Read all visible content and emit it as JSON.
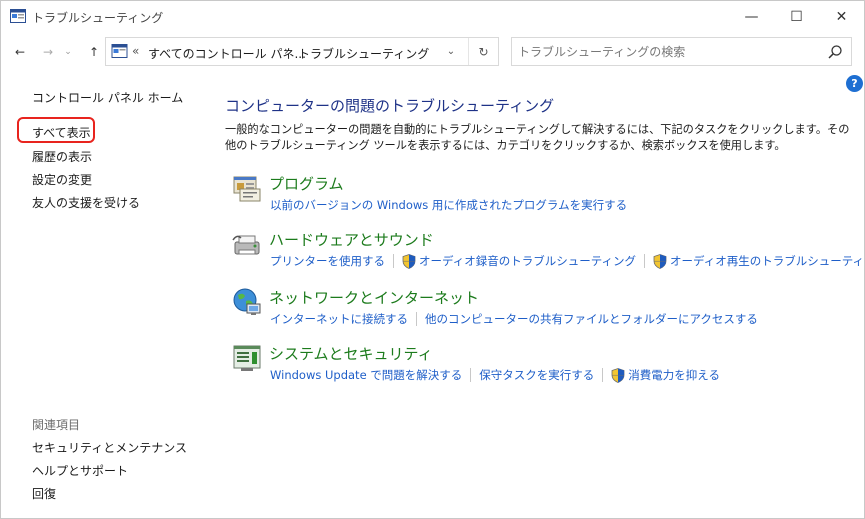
{
  "window": {
    "title": "トラブルシューティング",
    "minimize_glyph": "—",
    "maximize_glyph": "☐",
    "close_glyph": "✕"
  },
  "nav": {
    "back_glyph": "←",
    "forward_glyph": "→",
    "recent_glyph": "⌄",
    "up_glyph": "↑"
  },
  "address": {
    "overflow": "«",
    "crumb1": "すべてのコントロール パネ...",
    "separator": "›",
    "crumb2": "トラブルシューティング",
    "dropdown_glyph": "⌄",
    "refresh_glyph": "↻"
  },
  "search": {
    "placeholder": "トラブルシューティングの検索"
  },
  "help_glyph": "?",
  "sidebar": {
    "home": "コントロール パネル ホーム",
    "items": [
      "すべて表示",
      "履歴の表示",
      "設定の変更",
      "友人の支援を受ける"
    ],
    "see_also_title": "関連項目",
    "see_also": [
      "セキュリティとメンテナンス",
      "ヘルプとサポート",
      "回復"
    ]
  },
  "main": {
    "title": "コンピューターの問題のトラブルシューティング",
    "description": "一般的なコンピューターの問題を自動的にトラブルシューティングして解決するには、下記のタスクをクリックします。その他のトラブルシューティング ツールを表示するには、カテゴリをクリックするか、検索ボックスを使用します。",
    "categories": [
      {
        "icon": "programs-icon",
        "title": "プログラム",
        "links": [
          "以前のバージョンの Windows 用に作成されたプログラムを実行する"
        ]
      },
      {
        "icon": "hardware-sound-icon",
        "title": "ハードウェアとサウンド",
        "links": [
          "プリンターを使用する",
          "オーディオ録音のトラブルシューティング",
          "オーディオ再生のトラブルシューティング"
        ]
      },
      {
        "icon": "network-internet-icon",
        "title": "ネットワークとインターネット",
        "links": [
          "インターネットに接続する",
          "他のコンピューターの共有ファイルとフォルダーにアクセスする"
        ]
      },
      {
        "icon": "system-security-icon",
        "title": "システムとセキュリティ",
        "links": [
          "Windows Update で問題を解決する",
          "保守タスクを実行する",
          "消費電力を抑える"
        ]
      }
    ]
  },
  "colors": {
    "title_blue": "#1e3287",
    "category_green": "#1c7b1c",
    "link_blue": "#1e5ec8",
    "highlight_red": "#e8241e"
  }
}
